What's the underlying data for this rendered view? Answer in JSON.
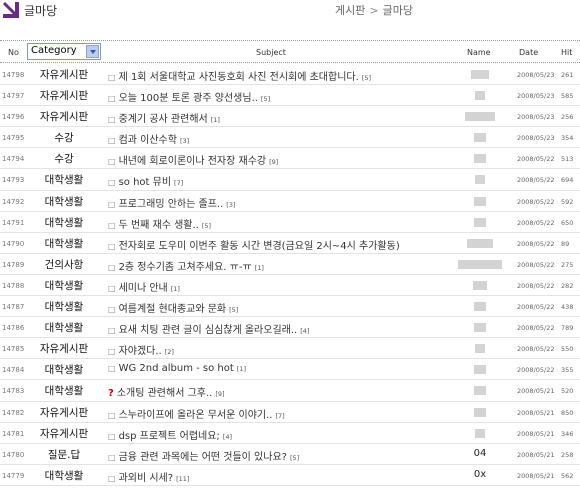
{
  "header": {
    "site_title": "글마당",
    "breadcrumb": [
      "게시판",
      "글마당"
    ],
    "breadcrumb_sep": ">",
    "logo_color": "#6a2a8c"
  },
  "columns": {
    "no": "No",
    "category_select": "Category",
    "subject": "Subject",
    "name": "Name",
    "date": "Date",
    "hit": "Hit"
  },
  "posts": [
    {
      "no": "14798",
      "category": "자유게시판",
      "subject": "제 1회 서울대학교 사진동호회 사진 전시회에 초대합니다.",
      "comments": "[5]",
      "name": "",
      "date": "2008/05/23",
      "hit": "261"
    },
    {
      "no": "14797",
      "category": "자유게시판",
      "subject": "오늘 100분 토론 광주 양선생님..",
      "comments": "[5]",
      "name": "",
      "date": "2008/05/23",
      "hit": "585"
    },
    {
      "no": "14796",
      "category": "자유게시판",
      "subject": "중계기 공사 관련해서",
      "comments": "[1]",
      "name": "",
      "date": "2008/05/23",
      "hit": "256"
    },
    {
      "no": "14795",
      "category": "수강",
      "subject": "컴과 이산수학",
      "comments": "[3]",
      "name": "",
      "date": "2008/05/23",
      "hit": "354"
    },
    {
      "no": "14794",
      "category": "수강",
      "subject": "내년에 회로이론이나 전자장 재수강",
      "comments": "[9]",
      "name": "",
      "date": "2008/05/22",
      "hit": "513"
    },
    {
      "no": "14793",
      "category": "대학생활",
      "subject": "so hot 뮤비",
      "comments": "[7]",
      "name": "",
      "date": "2008/05/22",
      "hit": "694"
    },
    {
      "no": "14792",
      "category": "대학생활",
      "subject": "프로그래밍 안하는 졸프..",
      "comments": "[3]",
      "name": "",
      "date": "2008/05/22",
      "hit": "592"
    },
    {
      "no": "14791",
      "category": "대학생활",
      "subject": "두 번째 재수 생활..",
      "comments": "[5]",
      "name": "",
      "date": "2008/05/22",
      "hit": "650"
    },
    {
      "no": "14790",
      "category": "대학생활",
      "subject": "전자회로 도우미 이번주 활동 시간 변경(금요일 2시~4시 추가활동)",
      "comments": "",
      "name": "",
      "date": "2008/05/22",
      "hit": "89"
    },
    {
      "no": "14789",
      "category": "건의사항",
      "subject": "2층 정수기좀 고쳐주세요. ㅠ-ㅠ",
      "comments": "[1]",
      "name": "",
      "date": "2008/05/22",
      "hit": "275"
    },
    {
      "no": "14788",
      "category": "대학생활",
      "subject": "세미나 안내",
      "comments": "[1]",
      "name": "",
      "date": "2008/05/22",
      "hit": "282"
    },
    {
      "no": "14787",
      "category": "대학생활",
      "subject": "여름계절 현대종교와 문화",
      "comments": "[5]",
      "name": "",
      "date": "2008/05/22",
      "hit": "438"
    },
    {
      "no": "14786",
      "category": "대학생활",
      "subject": "요새 치팅 관련 글이 심심찮게 올라오길래..",
      "comments": "[4]",
      "name": "",
      "date": "2008/05/22",
      "hit": "789"
    },
    {
      "no": "14785",
      "category": "자유게시판",
      "subject": "자야겠다..",
      "comments": "[2]",
      "name": "",
      "date": "2008/05/22",
      "hit": "550"
    },
    {
      "no": "14784",
      "category": "대학생활",
      "subject": "WG 2nd album - so hot",
      "comments": "[1]",
      "name": "",
      "date": "2008/05/22",
      "hit": "355"
    },
    {
      "no": "14783",
      "category": "대학생활",
      "subject": "소개팅 관련해서 그후..",
      "comments": "[9]",
      "name": "",
      "date": "2008/05/21",
      "hit": "520",
      "marker": "?"
    },
    {
      "no": "14782",
      "category": "자유게시판",
      "subject": "스누라이프에 올라온 무서운 이야기..",
      "comments": "[7]",
      "name": "",
      "date": "2008/05/21",
      "hit": "850"
    },
    {
      "no": "14781",
      "category": "자유게시판",
      "subject": "dsp 프로젝트 어렵네요;",
      "comments": "[4]",
      "name": "",
      "date": "2008/05/21",
      "hit": "346"
    },
    {
      "no": "14780",
      "category": "질문.답",
      "subject": "금융 관련 과목에는 어떤 것들이 있나요?",
      "comments": "[5]",
      "name": "04",
      "date": "2008/05/21",
      "hit": "258"
    },
    {
      "no": "14779",
      "category": "대학생활",
      "subject": "과외비 시세?",
      "comments": "[11]",
      "name": "0x",
      "date": "2008/05/21",
      "hit": "562"
    }
  ]
}
